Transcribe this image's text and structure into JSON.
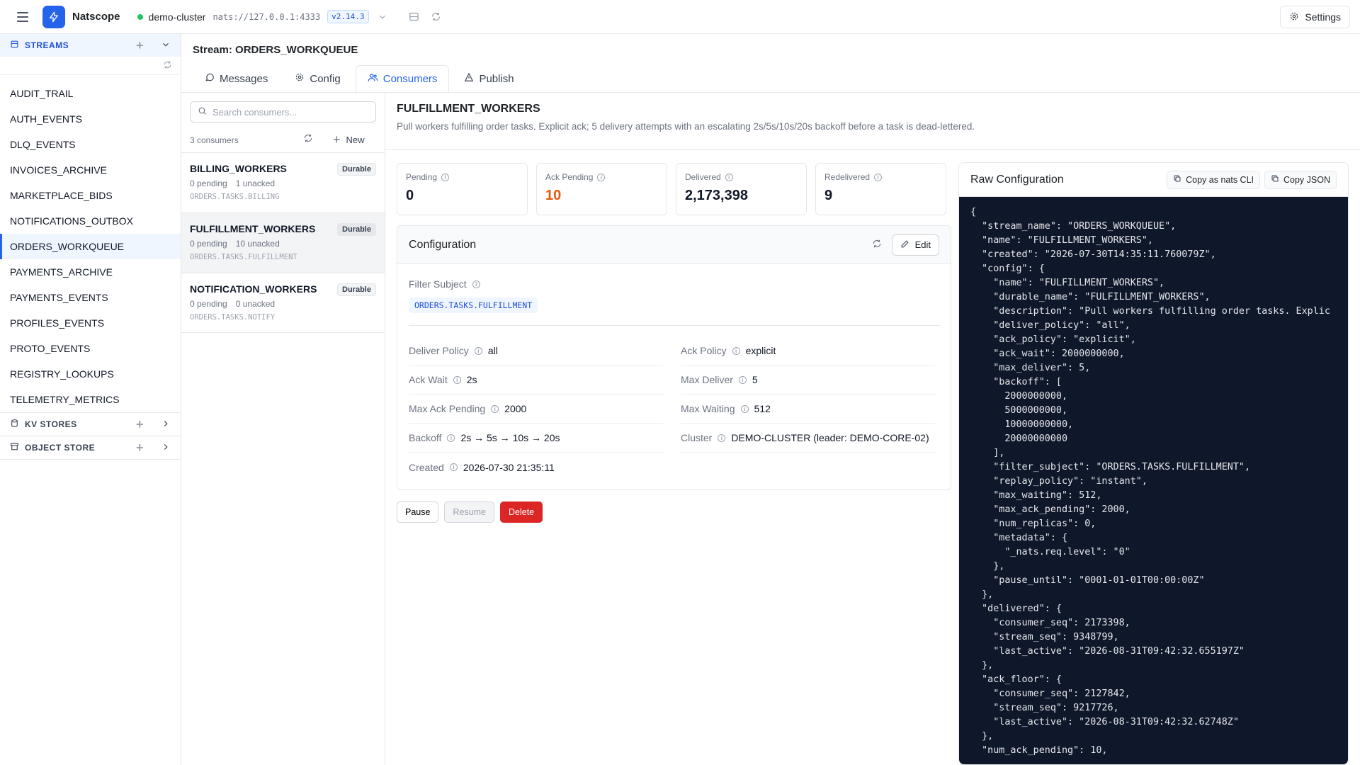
{
  "app": {
    "name": "Natscope",
    "cluster": "demo-cluster",
    "url": "nats://127.0.0.1:4333",
    "version": "v2.14.3",
    "settings_label": "Settings"
  },
  "sidebar": {
    "streams_label": "STREAMS",
    "streams": [
      "AUDIT_TRAIL",
      "AUTH_EVENTS",
      "DLQ_EVENTS",
      "INVOICES_ARCHIVE",
      "MARKETPLACE_BIDS",
      "NOTIFICATIONS_OUTBOX",
      "ORDERS_WORKQUEUE",
      "PAYMENTS_ARCHIVE",
      "PAYMENTS_EVENTS",
      "PROFILES_EVENTS",
      "PROTO_EVENTS",
      "REGISTRY_LOOKUPS",
      "TELEMETRY_METRICS"
    ],
    "kv_label": "KV STORES",
    "object_label": "OBJECT STORE"
  },
  "stream": {
    "title": "Stream: ORDERS_WORKQUEUE"
  },
  "tabs": [
    {
      "label": "Messages"
    },
    {
      "label": "Config"
    },
    {
      "label": "Consumers"
    },
    {
      "label": "Publish"
    }
  ],
  "consumers": {
    "search_placeholder": "Search consumers...",
    "count": "3 consumers",
    "new_label": "New",
    "items": [
      {
        "name": "BILLING_WORKERS",
        "badge": "Durable",
        "pending": "0 pending",
        "unacked": "1 unacked",
        "subject": "ORDERS.TASKS.BILLING"
      },
      {
        "name": "FULFILLMENT_WORKERS",
        "badge": "Durable",
        "pending": "0 pending",
        "unacked": "10 unacked",
        "subject": "ORDERS.TASKS.FULFILLMENT"
      },
      {
        "name": "NOTIFICATION_WORKERS",
        "badge": "Durable",
        "pending": "0 pending",
        "unacked": "0 unacked",
        "subject": "ORDERS.TASKS.NOTIFY"
      }
    ]
  },
  "detail": {
    "name": "FULFILLMENT_WORKERS",
    "description": "Pull workers fulfilling order tasks. Explicit ack; 5 delivery attempts with an escalating 2s/5s/10s/20s backoff before a task is dead-lettered.",
    "stats": [
      {
        "label": "Pending",
        "value": "0",
        "color": "#111827"
      },
      {
        "label": "Ack Pending",
        "value": "10",
        "color": "#ea580c"
      },
      {
        "label": "Delivered",
        "value": "2,173,398",
        "color": "#111827"
      },
      {
        "label": "Redelivered",
        "value": "9",
        "color": "#111827"
      }
    ],
    "config_title": "Configuration",
    "edit_label": "Edit",
    "filter_subject_label": "Filter Subject",
    "filter_subject": "ORDERS.TASKS.FULFILLMENT",
    "fields": [
      {
        "k": "Deliver Policy",
        "v": "all"
      },
      {
        "k": "Ack Policy",
        "v": "explicit"
      },
      {
        "k": "Ack Wait",
        "v": "2s"
      },
      {
        "k": "Max Deliver",
        "v": "5"
      },
      {
        "k": "Max Ack Pending",
        "v": "2000"
      },
      {
        "k": "Max Waiting",
        "v": "512"
      },
      {
        "k": "Backoff",
        "v": "2s → 5s → 10s → 20s"
      },
      {
        "k": "Cluster",
        "v": "DEMO-CLUSTER (leader: DEMO-CORE-02)"
      },
      {
        "k": "Created",
        "v": "2026-07-30 21:35:11"
      }
    ],
    "actions": {
      "pause": "Pause",
      "resume": "Resume",
      "delete": "Delete"
    }
  },
  "raw": {
    "title": "Raw Configuration",
    "copy_cli": "Copy as nats CLI",
    "copy_json": "Copy JSON",
    "lines": [
      "{",
      "  \"stream_name\": \"ORDERS_WORKQUEUE\",",
      "  \"name\": \"FULFILLMENT_WORKERS\",",
      "  \"created\": \"2026-07-30T14:35:11.760079Z\",",
      "  \"config\": {",
      "    \"name\": \"FULFILLMENT_WORKERS\",",
      "    \"durable_name\": \"FULFILLMENT_WORKERS\",",
      "    \"description\": \"Pull workers fulfilling order tasks. Explic",
      "    \"deliver_policy\": \"all\",",
      "    \"ack_policy\": \"explicit\",",
      "    \"ack_wait\": 2000000000,",
      "    \"max_deliver\": 5,",
      "    \"backoff\": [",
      "      2000000000,",
      "      5000000000,",
      "      10000000000,",
      "      20000000000",
      "    ],",
      "    \"filter_subject\": \"ORDERS.TASKS.FULFILLMENT\",",
      "    \"replay_policy\": \"instant\",",
      "    \"max_waiting\": 512,",
      "    \"max_ack_pending\": 2000,",
      "    \"num_replicas\": 0,",
      "    \"metadata\": {",
      "      \"_nats.req.level\": \"0\"",
      "    },",
      "    \"pause_until\": \"0001-01-01T00:00:00Z\"",
      "  },",
      "  \"delivered\": {",
      "    \"consumer_seq\": 2173398,",
      "    \"stream_seq\": 9348799,",
      "    \"last_active\": \"2026-08-31T09:42:32.655197Z\"",
      "  },",
      "  \"ack_floor\": {",
      "    \"consumer_seq\": 2127842,",
      "    \"stream_seq\": 9217726,",
      "    \"last_active\": \"2026-08-31T09:42:32.62748Z\"",
      "  },",
      "  \"num_ack_pending\": 10,"
    ]
  }
}
